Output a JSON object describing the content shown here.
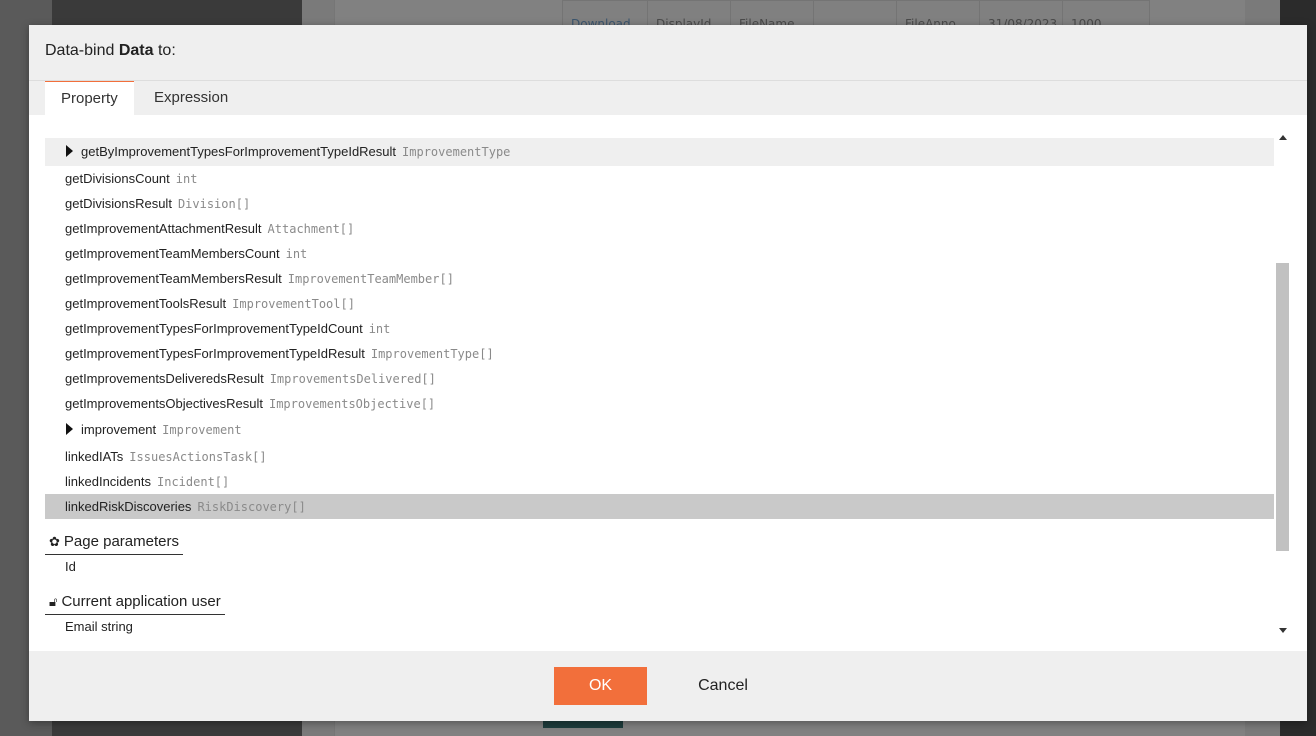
{
  "background": {
    "table_cells": [
      "Download",
      "DisplayId",
      "FileName",
      "",
      "FileAnno",
      "31/08/2023",
      "1000"
    ]
  },
  "dialog": {
    "title_prefix": "Data-bind",
    "title_bold": "Data",
    "title_suffix": "to:",
    "tabs": [
      {
        "label": "Property",
        "active": true
      },
      {
        "label": "Expression",
        "active": false
      }
    ],
    "items": [
      {
        "name": "getByImprovementTypesForImprovementTypeIdResult",
        "type": "ImprovementType",
        "expandable": true,
        "state": "hover"
      },
      {
        "name": "getDivisionsCount",
        "type": "int"
      },
      {
        "name": "getDivisionsResult",
        "type": "Division[]"
      },
      {
        "name": "getImprovementAttachmentResult",
        "type": "Attachment[]"
      },
      {
        "name": "getImprovementTeamMembersCount",
        "type": "int"
      },
      {
        "name": "getImprovementTeamMembersResult",
        "type": "ImprovementTeamMember[]"
      },
      {
        "name": "getImprovementToolsResult",
        "type": "ImprovementTool[]"
      },
      {
        "name": "getImprovementTypesForImprovementTypeIdCount",
        "type": "int"
      },
      {
        "name": "getImprovementTypesForImprovementTypeIdResult",
        "type": "ImprovementType[]"
      },
      {
        "name": "getImprovementsDeliveredsResult",
        "type": "ImprovementsDelivered[]"
      },
      {
        "name": "getImprovementsObjectivesResult",
        "type": "ImprovementsObjective[]"
      },
      {
        "name": "improvement",
        "type": "Improvement",
        "expandable": true
      },
      {
        "name": "linkedIATs",
        "type": "IssuesActionsTask[]"
      },
      {
        "name": "linkedIncidents",
        "type": "Incident[]"
      },
      {
        "name": "linkedRiskDiscoveries",
        "type": "RiskDiscovery[]",
        "state": "selected"
      }
    ],
    "page_parameters": {
      "label": "Page parameters",
      "icon": "gear-icon",
      "items": [
        "Id"
      ]
    },
    "current_user": {
      "label": "Current application user",
      "icon": "lock-icon",
      "items": [
        "Email  string"
      ]
    },
    "ok_label": "OK",
    "cancel_label": "Cancel",
    "accent_color": "#f26f3b"
  }
}
